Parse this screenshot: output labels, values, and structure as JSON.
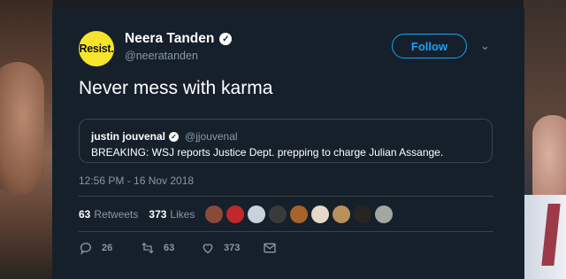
{
  "author": {
    "avatar_text": "Resist.",
    "name": "Neera Tanden",
    "handle": "@neeratanden"
  },
  "follow_label": "Follow",
  "tweet_text": "Never mess with karma",
  "quoted": {
    "name": "justin jouvenal",
    "handle": "@jjouvenal",
    "text": "BREAKING: WSJ reports Justice Dept. prepping to charge Julian Assange."
  },
  "timestamp": "12:56 PM - 16 Nov 2018",
  "stats": {
    "retweets_count": "63",
    "retweets_label": "Retweets",
    "likes_count": "373",
    "likes_label": "Likes"
  },
  "likers": [
    {
      "color": "#8a4a3a"
    },
    {
      "color": "#c0282a"
    },
    {
      "color": "#c8d2dc"
    },
    {
      "color": "#3a3a3a"
    },
    {
      "color": "#a8622a"
    },
    {
      "color": "#e8d8c8"
    },
    {
      "color": "#b8905a"
    },
    {
      "color": "#2a2420"
    },
    {
      "color": "#a0a8a0"
    }
  ],
  "actions": {
    "reply_count": "26",
    "retweet_count": "63",
    "like_count": "373"
  },
  "colors": {
    "card_bg": "#15202b",
    "accent": "#1da1f2",
    "muted": "#8899a6",
    "border": "#38444d",
    "avatar_bg": "#f7e52c"
  }
}
